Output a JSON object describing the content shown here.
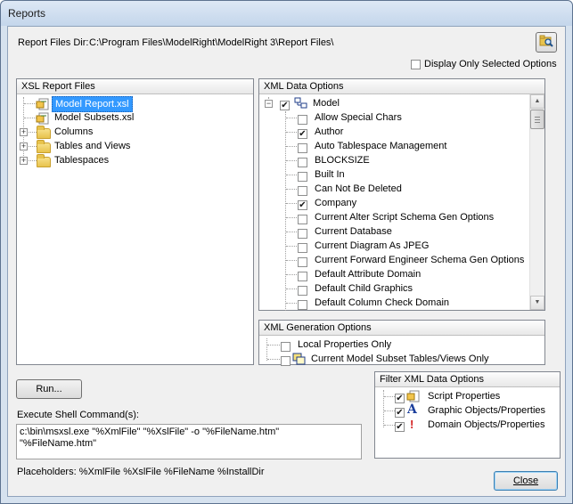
{
  "window": {
    "title": "Reports"
  },
  "report_dir": {
    "label": "Report Files Dir:",
    "value": "C:\\Program Files\\ModelRight\\ModelRight 3\\Report Files\\"
  },
  "display_only_selected": {
    "label": "Display Only Selected Options",
    "checked": false
  },
  "xsl_panel": {
    "header": "XSL Report Files",
    "items": [
      {
        "label": "Model Report.xsl",
        "type": "file",
        "selected": true
      },
      {
        "label": "Model Subsets.xsl",
        "type": "file",
        "selected": false
      },
      {
        "label": "Columns",
        "type": "folder",
        "selected": false
      },
      {
        "label": "Tables and Views",
        "type": "folder",
        "selected": false
      },
      {
        "label": "Tablespaces",
        "type": "folder",
        "selected": false
      }
    ]
  },
  "xml_data_panel": {
    "header": "XML Data Options",
    "root": {
      "label": "Model",
      "checked": true
    },
    "items": [
      {
        "label": "Allow Special Chars",
        "checked": false
      },
      {
        "label": "Author",
        "checked": true
      },
      {
        "label": "Auto Tablespace Management",
        "checked": false
      },
      {
        "label": "BLOCKSIZE",
        "checked": false
      },
      {
        "label": "Built In",
        "checked": false
      },
      {
        "label": "Can Not Be Deleted",
        "checked": false
      },
      {
        "label": "Company",
        "checked": true
      },
      {
        "label": "Current Alter Script Schema Gen Options",
        "checked": false
      },
      {
        "label": "Current Database",
        "checked": false
      },
      {
        "label": "Current Diagram As JPEG",
        "checked": false
      },
      {
        "label": "Current Forward Engineer Schema Gen Options",
        "checked": false
      },
      {
        "label": "Default Attribute Domain",
        "checked": false
      },
      {
        "label": "Default Child Graphics",
        "checked": false
      },
      {
        "label": "Default Column Check Domain",
        "checked": false
      }
    ]
  },
  "xml_gen_panel": {
    "header": "XML Generation Options",
    "items": [
      {
        "label": "Local Properties Only",
        "checked": false
      },
      {
        "label": "Current Model Subset Tables/Views Only",
        "checked": false
      }
    ]
  },
  "filter_panel": {
    "header": "Filter XML Data Options",
    "items": [
      {
        "label": "Script Properties",
        "checked": true,
        "icon": "script-icon"
      },
      {
        "label": "Graphic Objects/Properties",
        "checked": true,
        "icon": "graphic-icon"
      },
      {
        "label": "Domain Objects/Properties",
        "checked": true,
        "icon": "domain-icon"
      }
    ]
  },
  "run_button": {
    "label": "Run..."
  },
  "shell_command": {
    "label": "Execute Shell Command(s):",
    "value": "c:\\bin\\msxsl.exe \"%XmlFile\" \"%XslFile\" -o \"%FileName.htm\"\n\"%FileName.htm\""
  },
  "placeholders": {
    "label": "Placeholders: %XmlFile %XslFile %FileName %InstallDir"
  },
  "close_button": {
    "label": "Close"
  },
  "colors": {
    "selection": "#3399ff",
    "frame": "#d6e2ef"
  }
}
